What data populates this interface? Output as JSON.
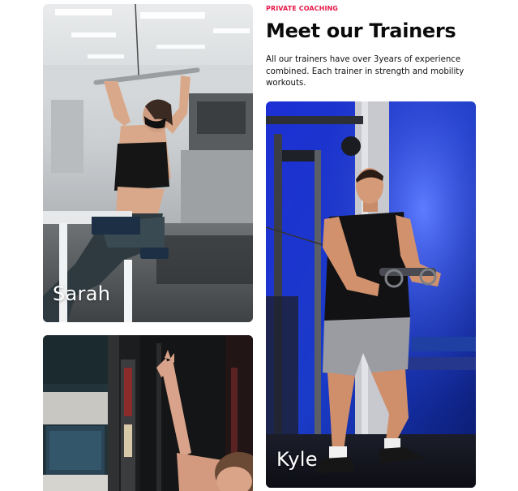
{
  "section": {
    "eyebrow": "PRIVATE COACHING",
    "title": "Meet our Trainers",
    "description": "All our trainers have over 3years of experience combined. Each trainer in strength and mobility workouts.",
    "accent_color": "#e5194a"
  },
  "trainers": [
    {
      "name": "Sarah"
    },
    {
      "name": "Kyle"
    },
    {
      "name": ""
    }
  ]
}
